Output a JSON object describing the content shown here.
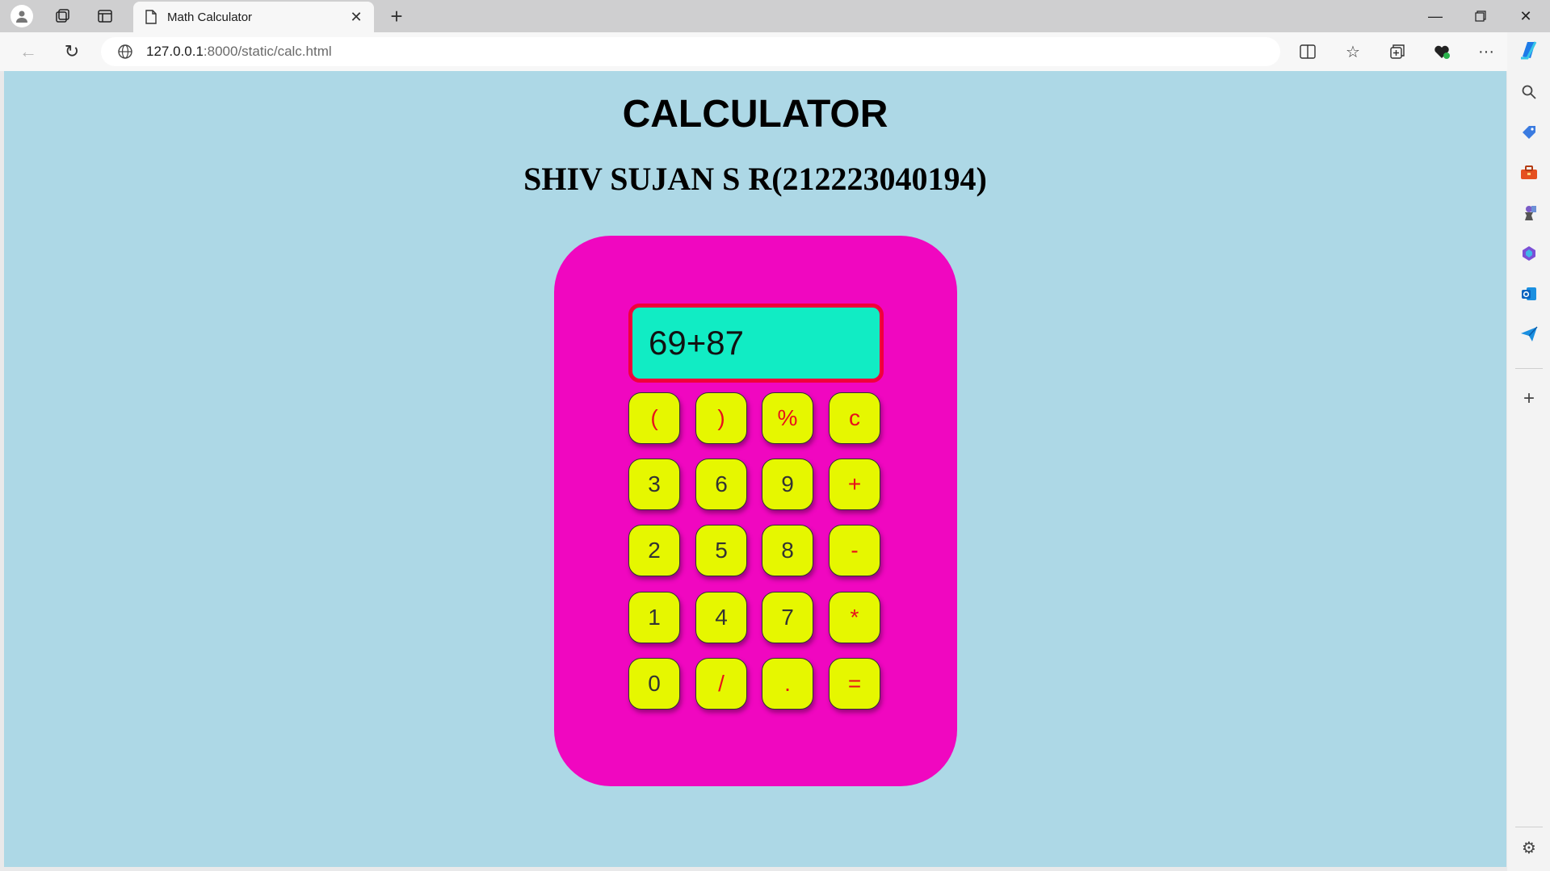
{
  "browser": {
    "tab_title": "Math Calculator",
    "url_host": "127.0.0.1",
    "url_rest": ":8000/static/calc.html"
  },
  "page": {
    "title": "CALCULATOR",
    "subtitle": "SHIV SUJAN S R(212223040194)"
  },
  "calculator": {
    "display_value": "69+87",
    "colors": {
      "page_bg": "#add8e6",
      "body": "#f007c0",
      "display_bg": "#11ecc4",
      "display_border": "#f0003c",
      "key_bg": "#e6f700",
      "operator_text": "#e8101a"
    },
    "keys": [
      {
        "label": "(",
        "name": "open-paren"
      },
      {
        "label": ")",
        "name": "close-paren"
      },
      {
        "label": "%",
        "name": "percent"
      },
      {
        "label": "c",
        "name": "clear"
      },
      {
        "label": "3",
        "name": "digit-3"
      },
      {
        "label": "6",
        "name": "digit-6"
      },
      {
        "label": "9",
        "name": "digit-9"
      },
      {
        "label": "+",
        "name": "plus"
      },
      {
        "label": "2",
        "name": "digit-2"
      },
      {
        "label": "5",
        "name": "digit-5"
      },
      {
        "label": "8",
        "name": "digit-8"
      },
      {
        "label": "-",
        "name": "minus"
      },
      {
        "label": "1",
        "name": "digit-1"
      },
      {
        "label": "4",
        "name": "digit-4"
      },
      {
        "label": "7",
        "name": "digit-7"
      },
      {
        "label": "*",
        "name": "multiply"
      },
      {
        "label": "0",
        "name": "digit-0"
      },
      {
        "label": "/",
        "name": "divide"
      },
      {
        "label": ".",
        "name": "decimal"
      },
      {
        "label": "=",
        "name": "equals"
      }
    ]
  }
}
